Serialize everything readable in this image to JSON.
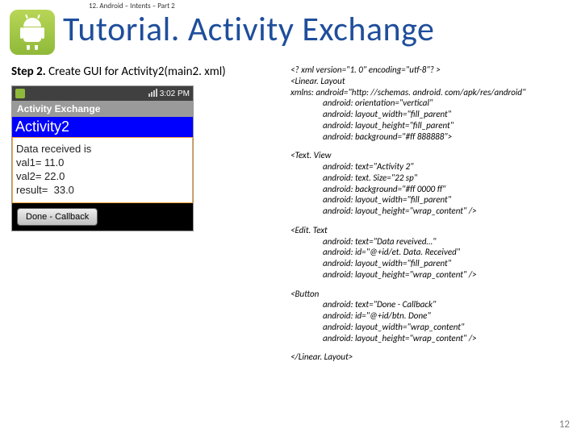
{
  "breadcrumb": "12. Android – Intents – Part 2",
  "title": "Tutorial. Activity Exchange",
  "step_label": "Step 2.",
  "step_text": " Create GUI for Activity2(main2. xml)",
  "device": {
    "time": "3:02 PM",
    "app_title": "Activity Exchange",
    "activity_label": "Activity2",
    "editbox": "Data received is\nval1= 11.0\nval2= 22.0\nresult=  33.0",
    "button": "Done - Callback"
  },
  "code": {
    "l1": "<? xml version=\"1. 0\" encoding=\"utf-8\"? >",
    "l2": "<Linear. Layout",
    "l3": "xmlns: android=\"http: //schemas. android. com/apk/res/android\"",
    "l4": "android: orientation=\"vertical\"",
    "l5": "android: layout_width=\"fill_parent\"",
    "l6": "android: layout_height=\"fill_parent\"",
    "l7": "android: background=\"#ff 888888\">",
    "t1": "<Text. View",
    "t2": "android: text=\"Activity 2\"",
    "t3": "android: text. Size=\"22 sp\"",
    "t4": "android: background=\"#ff 0000 ff\"",
    "t5": "android: layout_width=\"fill_parent\"",
    "t6": "android: layout_height=\"wrap_content\" />",
    "e1": "<Edit. Text",
    "e2": "android: text=\"Data reveived…\"",
    "e3": "android: id=\"@+id/et. Data. Received\"",
    "e4": "android: layout_width=\"fill_parent\"",
    "e5": "android: layout_height=\"wrap_content\" />",
    "b1": "<Button",
    "b2": "android: text=\"Done - Callback\"",
    "b3": "android: id=\"@+id/btn. Done\"",
    "b4": "android: layout_width=\"wrap_content\"",
    "b5": "android: layout_height=\"wrap_content\" />",
    "close": "</Linear. Layout>"
  },
  "page_number": "12"
}
